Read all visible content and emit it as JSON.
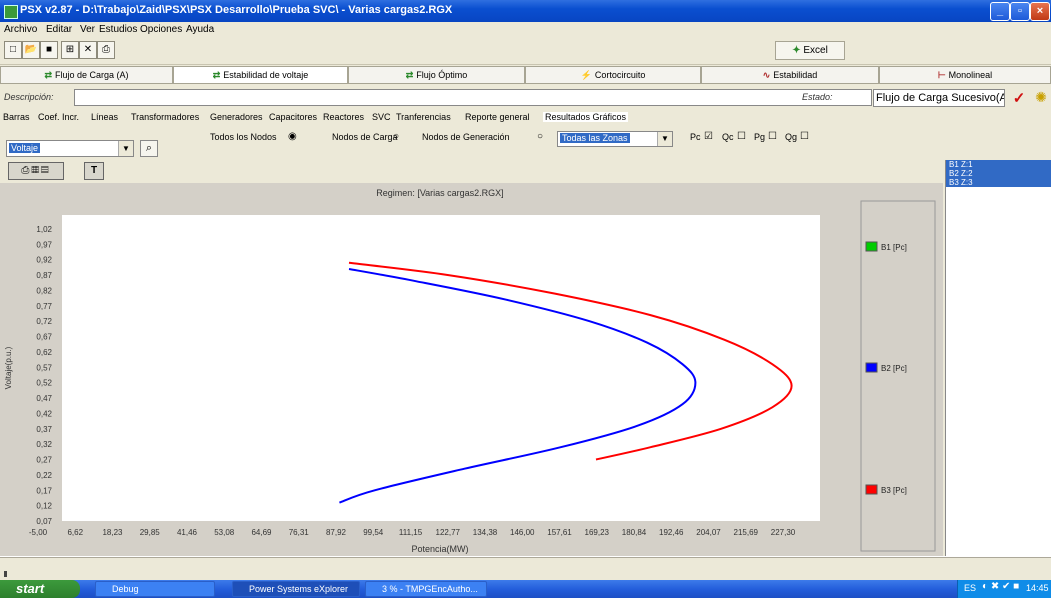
{
  "window": {
    "title": "PSX v2.87 - D:\\Trabajo\\Zaid\\PSX\\PSX Desarrollo\\Prueba SVC\\ - Varias cargas2.RGX"
  },
  "menu": [
    "Archivo",
    "Editar",
    "Ver",
    "Estudios",
    "Opciones",
    "Ayuda"
  ],
  "toolbar": {
    "excel_label": "Excel"
  },
  "main_tabs": [
    "Flujo de Carga (A)",
    "Estabilidad de voltaje",
    "Flujo Óptimo",
    "Cortocircuito",
    "Estabilidad",
    "Monolineal"
  ],
  "description": {
    "label": "Descripción:",
    "value": "",
    "estado_label": "Estado:",
    "estado_value": "Flujo de Carga Sucesivo(A)"
  },
  "sub_tabs": [
    "Barras",
    "Coef. Incr.",
    "Líneas",
    "Transformadores",
    "Generadores",
    "Capacitores",
    "Reactores",
    "SVC",
    "Tranferencias",
    "Reporte general",
    "Resultados Gráficos"
  ],
  "filters": {
    "variable_select": "Voltaje",
    "radio_all": "Todos los Nodos",
    "radio_load": "Nodos de Carga",
    "radio_gen": "Nodos de Generación",
    "zone_select": "Todas las Zonas",
    "checks": [
      {
        "label": "Pc",
        "checked": true
      },
      {
        "label": "Qc",
        "checked": false
      },
      {
        "label": "Pg",
        "checked": false
      },
      {
        "label": "Qg",
        "checked": false
      }
    ]
  },
  "right_panel": {
    "items": [
      "B1 Z:1",
      "B2 Z:2",
      "B3 Z:3"
    ]
  },
  "taskbar": {
    "start": "start",
    "tasks": [
      "Debug",
      "Power Systems eXplorer",
      "3 % - TMPGEncAutho..."
    ],
    "tray_lang": "ES",
    "clock": "14:45"
  },
  "chart_data": {
    "type": "line",
    "title": "Regimen: [Varias cargas2.RGX]",
    "xlabel": "Potencia(MW)",
    "ylabel": "Voltaje(p.u.)",
    "xlim": [
      -5.0,
      227.3
    ],
    "ylim": [
      0.07,
      1.02
    ],
    "x_ticks": [
      "-5,00",
      "6,62",
      "18,23",
      "29,85",
      "41,46",
      "53,08",
      "64,69",
      "76,31",
      "87,92",
      "99,54",
      "111,15",
      "122,77",
      "134,38",
      "146,00",
      "157,61",
      "169,23",
      "180,84",
      "192,46",
      "204,07",
      "215,69",
      "227,30"
    ],
    "y_ticks": [
      "1,02",
      "0,97",
      "0,92",
      "0,87",
      "0,82",
      "0,77",
      "0,72",
      "0,67",
      "0,62",
      "0,57",
      "0,52",
      "0,47",
      "0,42",
      "0,37",
      "0,32",
      "0,27",
      "0,22",
      "0,17",
      "0,12",
      "0,07"
    ],
    "legend_position": "right",
    "series": [
      {
        "name": "B1 [Pc]",
        "color": "#00cc00",
        "x": [],
        "y": []
      },
      {
        "name": "B2 [Pc]",
        "color": "#0000ff",
        "x": [
          82.0,
          103.0,
          131.0,
          157.0,
          175.0,
          186.0,
          190.0,
          186.0,
          172.0,
          148.0,
          118.0,
          90.0,
          79.0
        ],
        "y": [
          0.89,
          0.85,
          0.79,
          0.72,
          0.65,
          0.58,
          0.52,
          0.45,
          0.38,
          0.31,
          0.24,
          0.17,
          0.13
        ]
      },
      {
        "name": "B3 [Pc]",
        "color": "#ff0000",
        "x": [
          82.0,
          113.0,
          146.0,
          176.0,
          199.0,
          214.0,
          220.0,
          214.0,
          198.0,
          176.0,
          159.0
        ],
        "y": [
          0.91,
          0.87,
          0.81,
          0.74,
          0.66,
          0.58,
          0.51,
          0.44,
          0.37,
          0.31,
          0.27
        ]
      }
    ]
  }
}
